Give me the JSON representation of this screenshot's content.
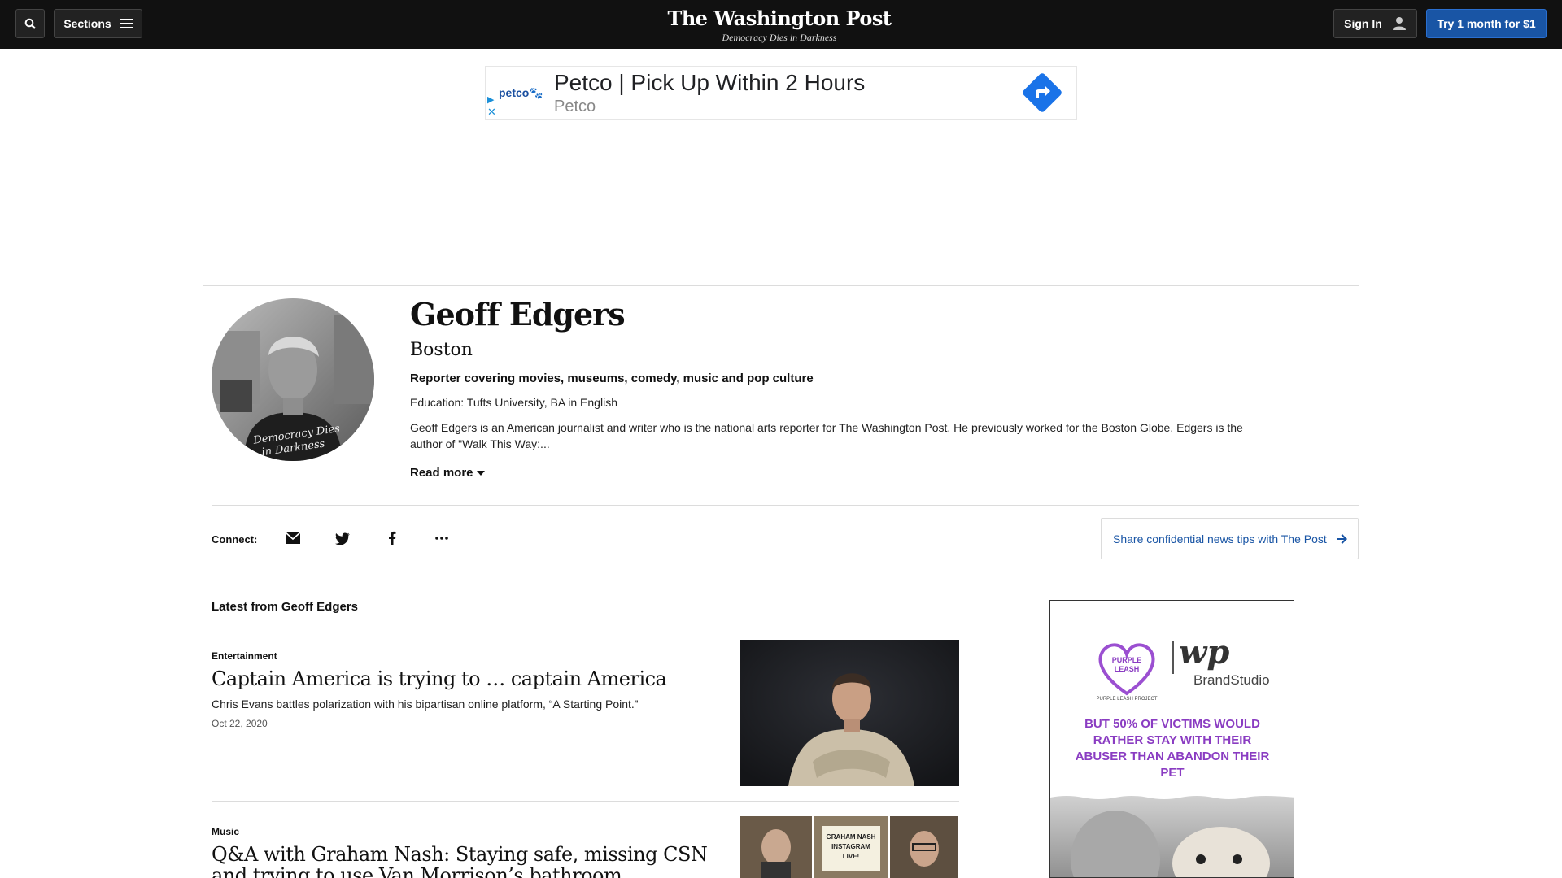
{
  "nav": {
    "sections_label": "Sections",
    "masthead_title": "The Washington Post",
    "masthead_tagline": "Democracy Dies in Darkness",
    "signin_label": "Sign In",
    "try_label": "Try 1 month for $1"
  },
  "ad_banner": {
    "brand_logo": "petco",
    "title": "Petco | Pick Up Within 2 Hours",
    "advertiser": "Petco"
  },
  "author": {
    "name": "Geoff Edgers",
    "location": "Boston",
    "role": "Reporter covering movies, museums, comedy, music and pop culture",
    "education": "Education: Tufts University, BA in English",
    "bio": "Geoff Edgers is an American journalist and writer who is the national arts reporter for The Washington Post. He previously worked for the Boston Globe. Edgers is the author of \"Walk This Way:...",
    "read_more": "Read more",
    "avatar_shirt_text": "Democracy Dies in Darkness"
  },
  "connect": {
    "label": "Connect:",
    "icons": [
      "email-icon",
      "twitter-icon",
      "facebook-icon",
      "more-icon"
    ],
    "tips_label": "Share confidential news tips with The Post"
  },
  "latest": {
    "heading": "Latest from Geoff Edgers",
    "articles": [
      {
        "kicker": "Entertainment",
        "headline": "Captain America is trying to … captain America",
        "blurb": "Chris Evans battles polarization with his bipartisan online platform, “A Starting Point.”",
        "date": "Oct 22, 2020"
      },
      {
        "kicker": "Music",
        "headline": "Q&A with Graham Nash: Staying safe, missing CSN and trying to use Van Morrison’s bathroom",
        "thumb_sign": "GRAHAM NASH INSTAGRAM LIVE!"
      }
    ]
  },
  "side_ad": {
    "partner": "PURPLE LEASH PROJECT",
    "wp_mark": "wp",
    "brand": "BrandStudio",
    "copy": "BUT 50% OF VICTIMS WOULD RATHER STAY WITH THEIR ABUSER THAN ABANDON THEIR PET"
  },
  "colors": {
    "nav_bg": "#111111",
    "accent_blue": "#1955a5",
    "ad_purple": "#8a3cc2"
  }
}
